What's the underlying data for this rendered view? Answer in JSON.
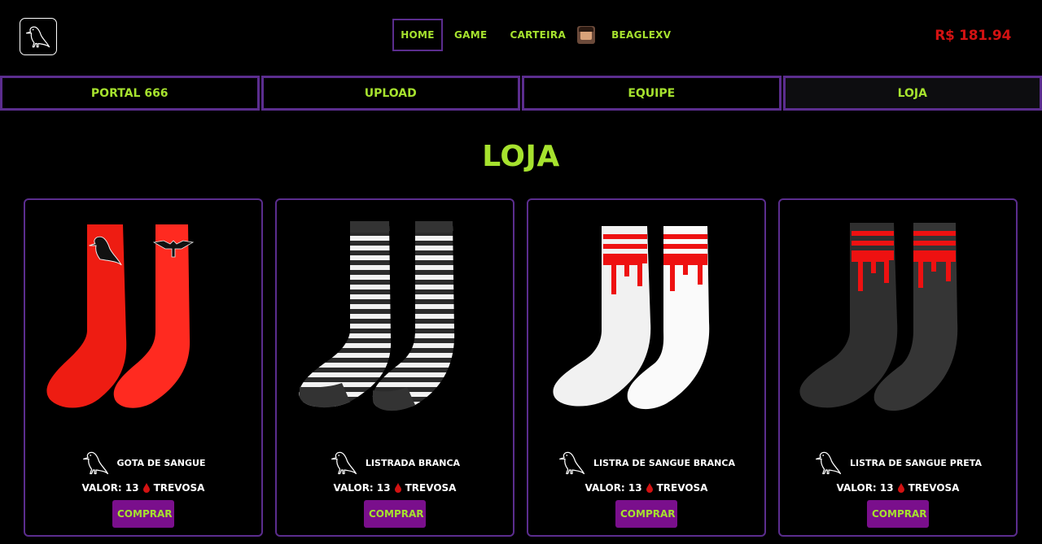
{
  "header": {
    "nav": {
      "home": "HOME",
      "game": "GAME",
      "wallet": "CARTEIRA",
      "user": "BEAGLEXV"
    },
    "balance": "R$ 181.94"
  },
  "tabs": [
    "PORTAL 666",
    "UPLOAD",
    "EQUIPE",
    "LOJA"
  ],
  "page_title": "LOJA",
  "products": [
    {
      "name": "GOTA DE SANGUE",
      "price_label": "VALOR: 13",
      "currency": "TREVOSA",
      "button": "COMPRAR"
    },
    {
      "name": "LISTRADA BRANCA",
      "price_label": "VALOR: 13",
      "currency": "TREVOSA",
      "button": "COMPRAR"
    },
    {
      "name": "LISTRA DE SANGUE BRANCA",
      "price_label": "VALOR: 13",
      "currency": "TREVOSA",
      "button": "COMPRAR"
    },
    {
      "name": "LISTRA DE SANGUE PRETA",
      "price_label": "VALOR: 13",
      "currency": "TREVOSA",
      "button": "COMPRAR"
    }
  ],
  "colors": {
    "accent_green": "#a6e22e",
    "border_purple": "#5b2d8e",
    "button_purple": "#7a0f8c",
    "balance_red": "#d31212",
    "blood_red": "#d31212"
  }
}
